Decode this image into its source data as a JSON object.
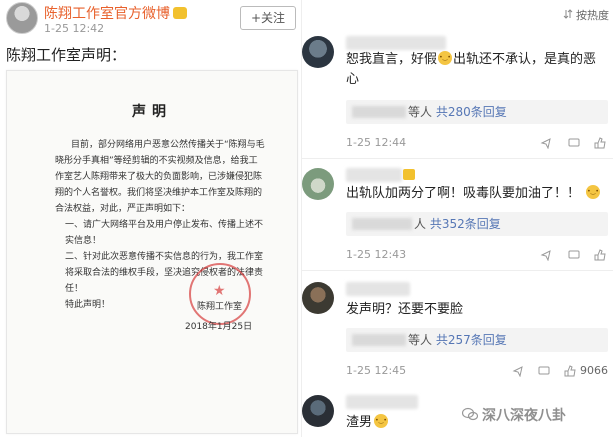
{
  "left_post": {
    "account_name": "陈翔工作室官方微博",
    "vip_icon": "vip-badge-icon",
    "time": "1-25 12:42",
    "follow_label": "+关注",
    "text": "陈翔工作室声明："
  },
  "statement": {
    "title": "声明",
    "paragraphs": [
      "目前，部分网络用户恶意公然传播关于“陈翔与毛晓彤分手真相”等经剪辑的不实视频及信息，给我工作室艺人陈翔带来了极大的负面影响，已涉嫌侵犯陈翔的个人名誉权。我们将坚决维护本工作室及陈翔的合法权益，对此，严正声明如下：",
      "一、请广大网络平台及用户停止发布、传播上述不实信息！",
      "二、针对此次恶意传播不实信息的行为，我工作室将采取合法的维权手段，坚决追究侵权者的法律责任！",
      "特此声明！"
    ],
    "signature": "陈翔工作室",
    "date": "2018年1月25日"
  },
  "comments_header": {
    "sort_label": "按热度",
    "sort_icon": "sort-icon"
  },
  "comments": [
    {
      "text": "恕我直言，好假",
      "text_after_emoji": "出轨还不承认，是真的恶心",
      "reply_suffix": "等人",
      "reply_link": "共280条回复",
      "time": "1-25 12:44",
      "like_count": ""
    },
    {
      "text": "出轨队加两分了啊！吸毒队要加油了！！",
      "reply_suffix": "人",
      "reply_link": "共352条回复",
      "time": "1-25 12:43",
      "like_count": ""
    },
    {
      "text": "发声明？还要不要脸",
      "reply_suffix": "等人",
      "reply_link": "共257条回复",
      "time": "1-25 12:45",
      "like_count": "9066"
    },
    {
      "text": "渣男",
      "reply_suffix": "",
      "reply_link": "",
      "time": "",
      "like_count": ""
    }
  ],
  "watermark": {
    "text": "深八深夜八卦",
    "icon": "wechat-icon"
  }
}
